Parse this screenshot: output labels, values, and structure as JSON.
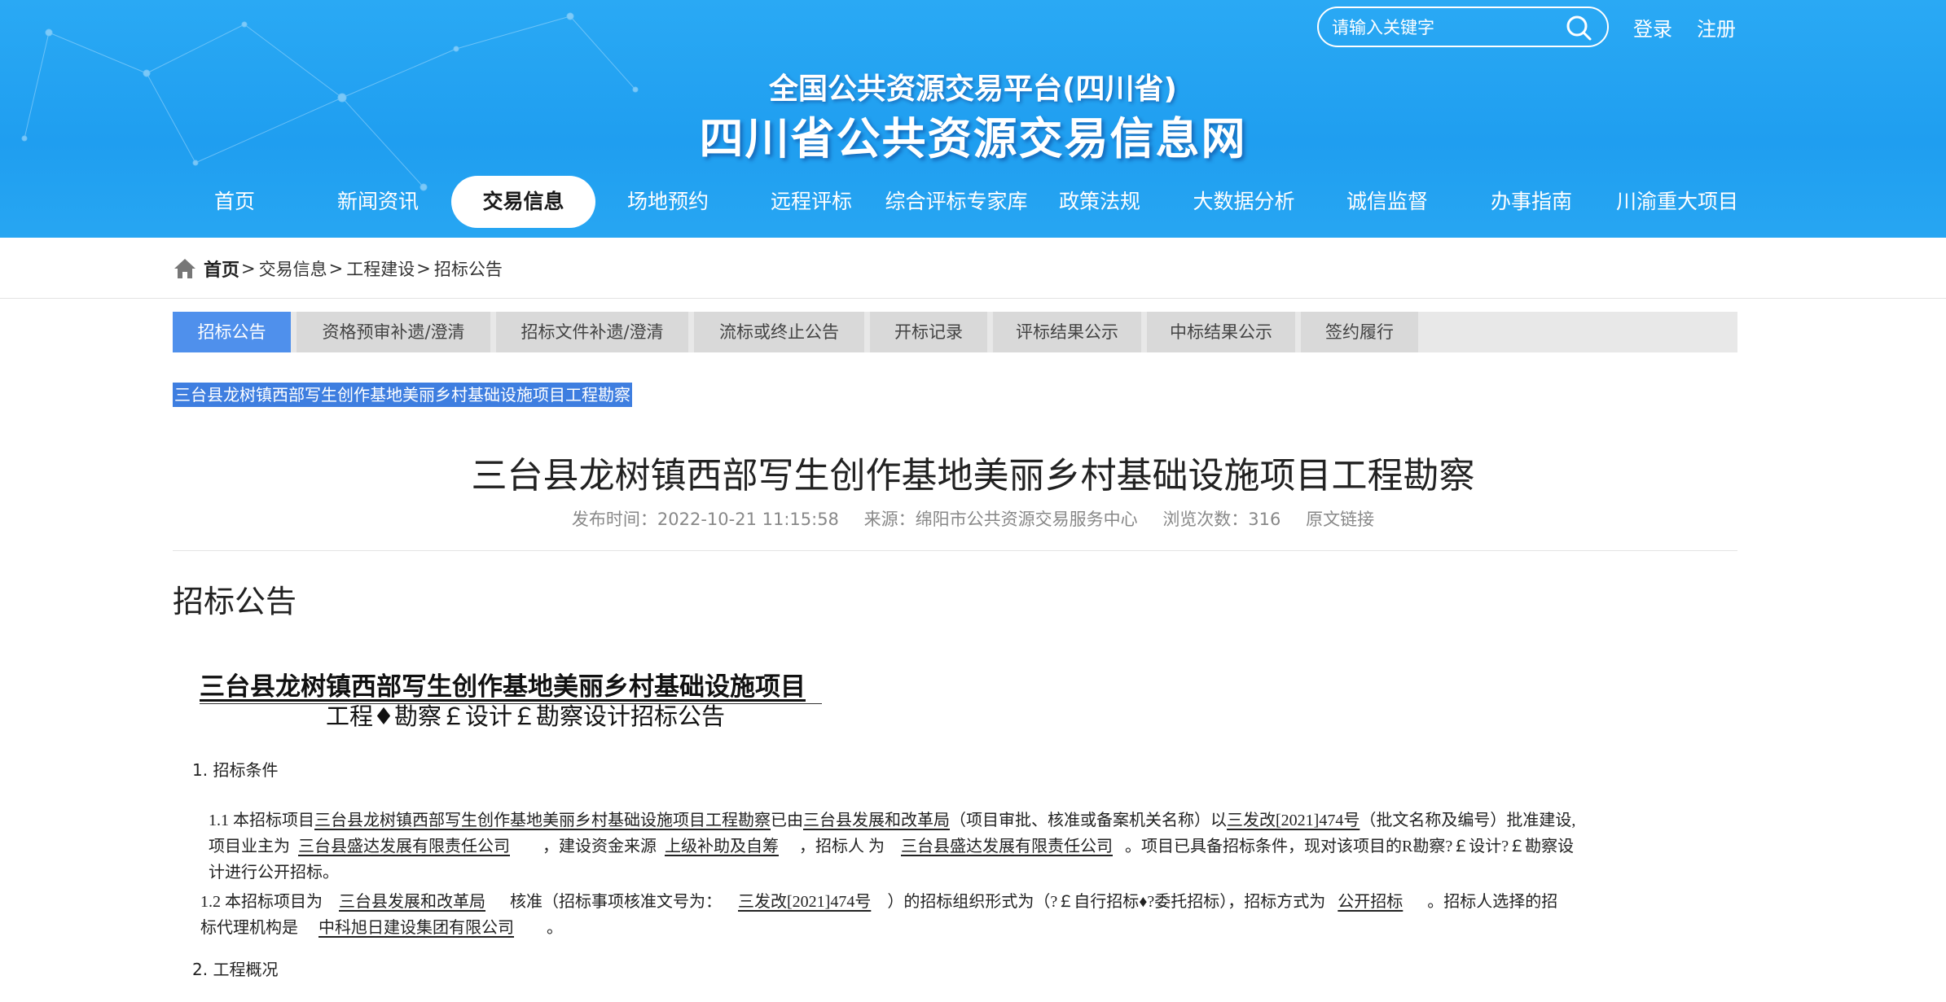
{
  "header": {
    "search_placeholder": "请输入关键字",
    "login": "登录",
    "register": "注册",
    "platform_sub": "全国公共资源交易平台(四川省)",
    "platform_title": "四川省公共资源交易信息网"
  },
  "nav": [
    "首页",
    "新闻资讯",
    "交易信息",
    "场地预约",
    "远程评标",
    "综合评标专家库",
    "政策法规",
    "大数据分析",
    "诚信监督",
    "办事指南",
    "川渝重大项目"
  ],
  "breadcrumb": {
    "home": "首页",
    "level1": "交易信息",
    "level2": "工程建设",
    "level3": "招标公告",
    "sep": ">"
  },
  "tabs": [
    "招标公告",
    "资格预审补遗/澄清",
    "招标文件补遗/澄清",
    "流标或终止公告",
    "开标记录",
    "评标结果公示",
    "中标结果公示",
    "签约履行"
  ],
  "article": {
    "highlight": "三台县龙树镇西部写生创作基地美丽乡村基础设施项目工程勘察",
    "title": "三台县龙树镇西部写生创作基地美丽乡村基础设施项目工程勘察",
    "publish_time": "发布时间：2022-10-21 11:15:58",
    "source": "来源：绵阳市公共资源交易服务中心",
    "views": "浏览次数：316",
    "original_link": "原文链接",
    "section_heading": "招标公告"
  },
  "doc": {
    "title_line1": "三台县龙树镇西部写生创作基地美丽乡村基础设施项目",
    "title_line2": "工程♦勘察￡设计￡勘察设计招标公告",
    "sec1": "1. 招标条件",
    "p11_a": "1.1  本招标项目",
    "p11_u1": "三台县龙树镇西部写生创作基地美丽乡村基础设施项目工程勘察",
    "p11_b": "已由",
    "p11_u2": "三台县发展和改革局",
    "p11_c": "（项目审批、核准或备案机关名称）以",
    "p11_u3": "三发改[2021]474号",
    "p11_d": "（批文名称及编号）批准建设,",
    "p11_e": "项目业主为",
    "p11_u4": "三台县盛达发展有限责任公司",
    "p11_f": "，建设资金来源",
    "p11_u5": "上级补助及自筹",
    "p11_g": "，招标人 为",
    "p11_u6": "三台县盛达发展有限责任公司",
    "p11_h": "。项目已具备招标条件，现对该项目的R勘察?￡设计?￡勘察设",
    "p11_i": "计进行公开招标。",
    "p12_a": "1.2  本招标项目为",
    "p12_u1": "三台县发展和改革局",
    "p12_b": "核准（招标事项核准文号为：",
    "p12_u2": "三发改[2021]474号",
    "p12_c": "）的招标组织形式为（?￡自行招标♦?委托招标），招标方式为",
    "p12_u3": "公开招标",
    "p12_d": "。招标人选择的招",
    "p12_e": "标代理机构是",
    "p12_u4": "中科旭日建设集团有限公司",
    "p12_f": "。",
    "sec2": "2. 工程概况"
  }
}
